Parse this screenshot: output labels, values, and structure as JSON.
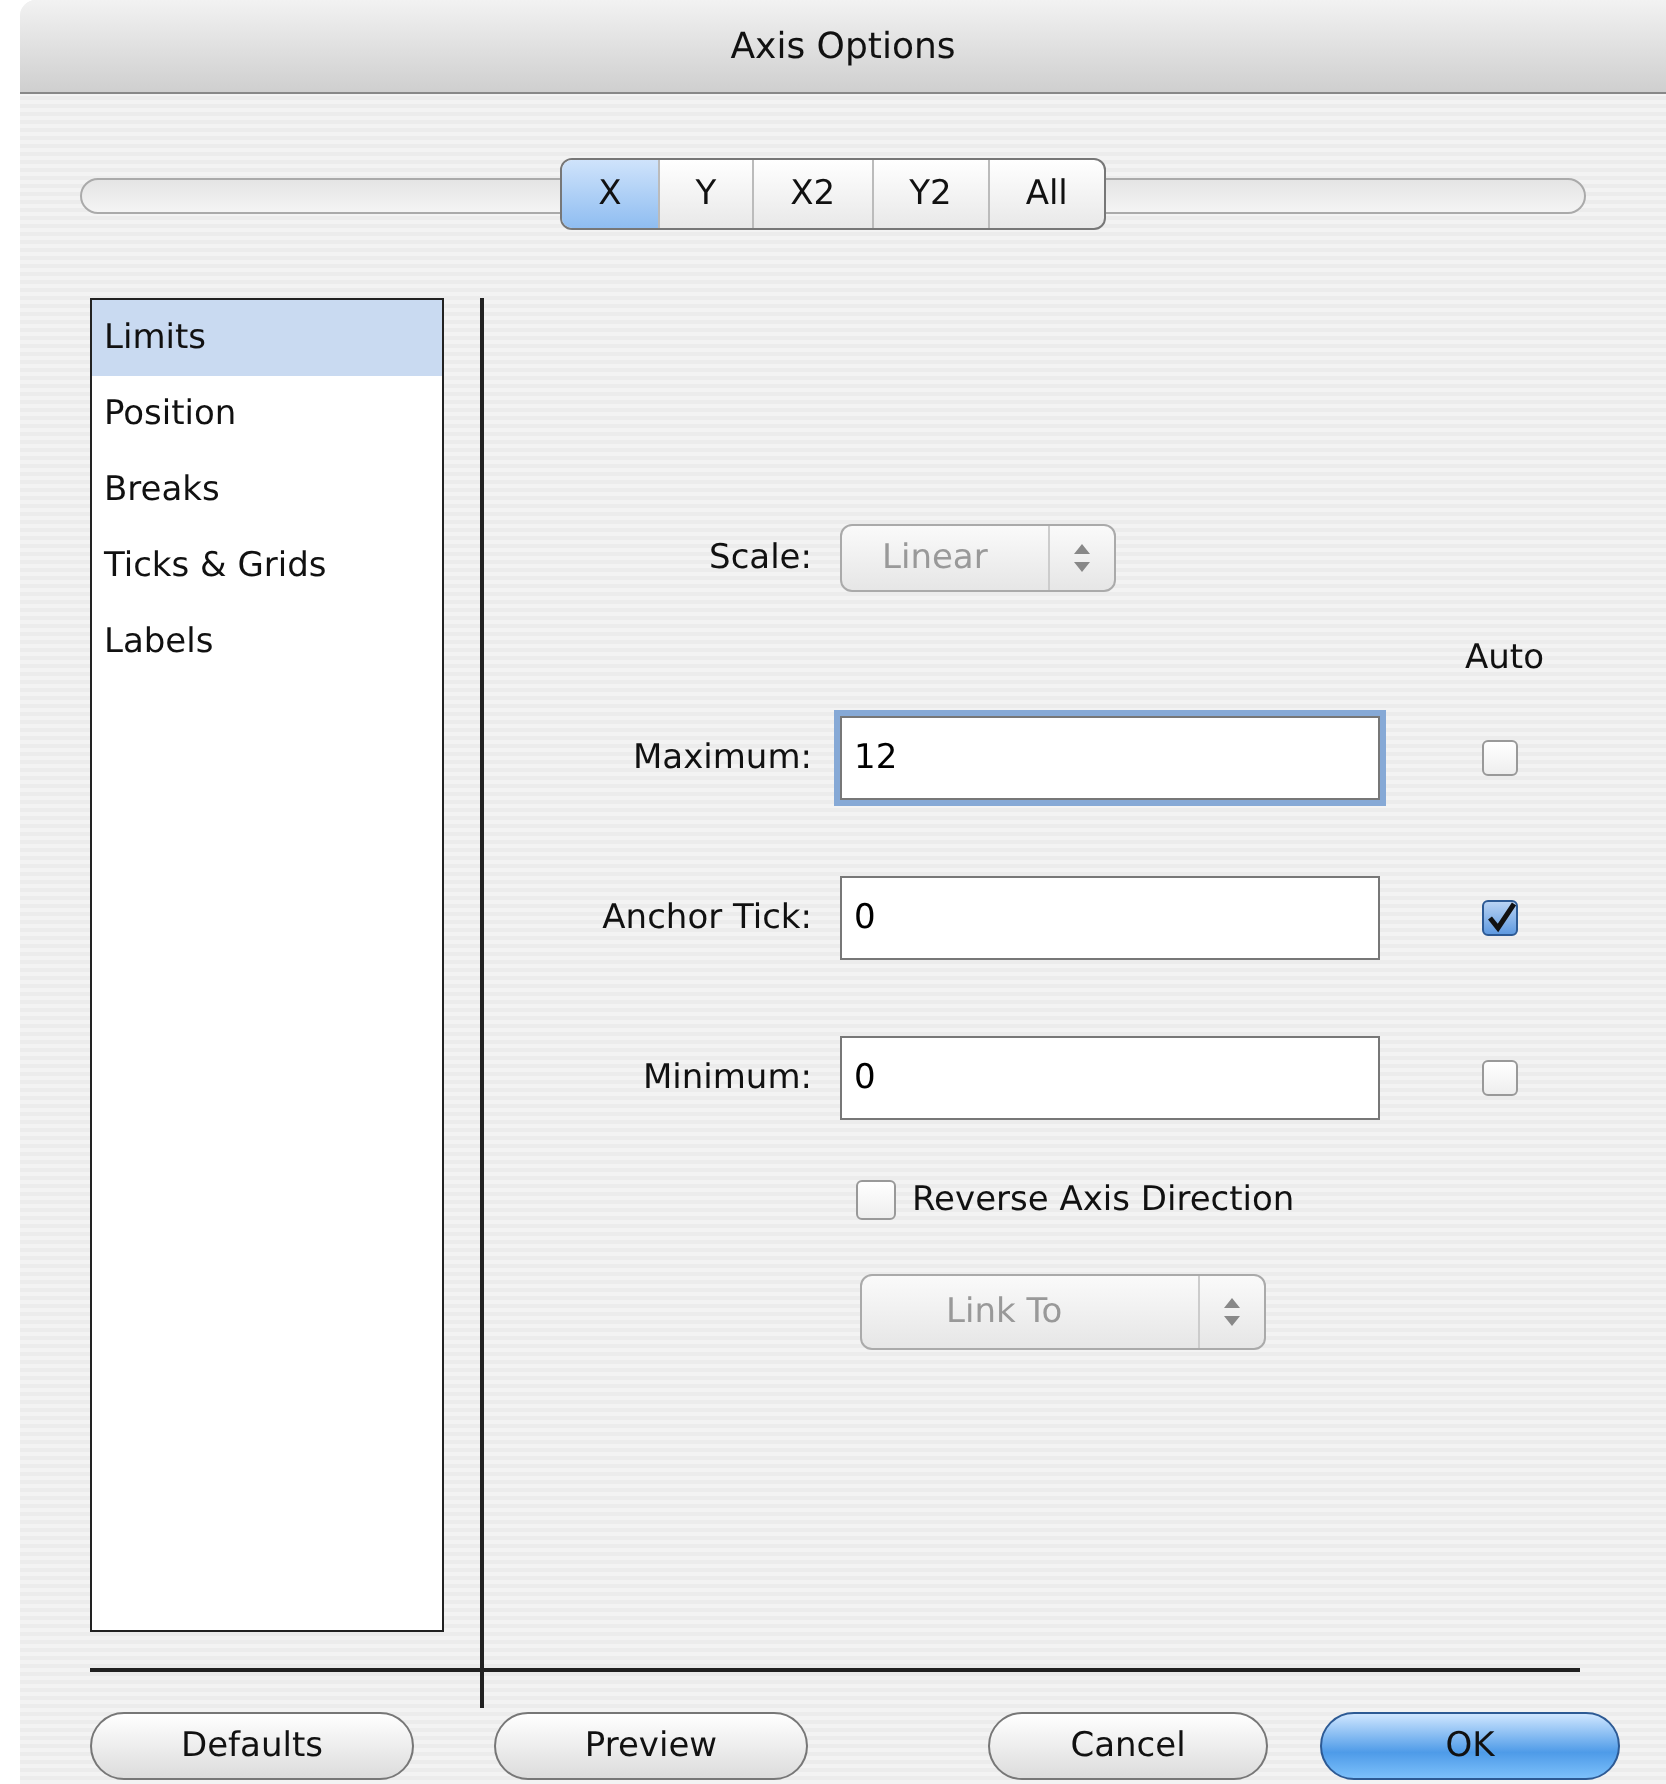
{
  "window": {
    "title": "Axis Options"
  },
  "tabs": [
    {
      "label": "X",
      "selected": true
    },
    {
      "label": "Y",
      "selected": false
    },
    {
      "label": "X2",
      "selected": false
    },
    {
      "label": "Y2",
      "selected": false
    },
    {
      "label": "All",
      "selected": false
    }
  ],
  "sidebar": {
    "items": [
      {
        "label": "Limits",
        "selected": true
      },
      {
        "label": "Position",
        "selected": false
      },
      {
        "label": "Breaks",
        "selected": false
      },
      {
        "label": "Ticks & Grids",
        "selected": false
      },
      {
        "label": "Labels",
        "selected": false
      }
    ]
  },
  "scale": {
    "label": "Scale:",
    "value": "Linear",
    "disabled": true
  },
  "auto_header": "Auto",
  "fields": [
    {
      "label": "Maximum:",
      "value": "12",
      "focused": true,
      "auto_checked": false
    },
    {
      "label": "Anchor Tick:",
      "value": "0",
      "focused": false,
      "auto_checked": true
    },
    {
      "label": "Minimum:",
      "value": "0",
      "focused": false,
      "auto_checked": false
    }
  ],
  "reverse": {
    "label": "Reverse Axis Direction",
    "checked": false
  },
  "link_to": {
    "value": "Link To",
    "disabled": true
  },
  "buttons": [
    {
      "label": "Defaults",
      "default": false
    },
    {
      "label": "Preview",
      "default": false
    },
    {
      "label": "Cancel",
      "default": false
    },
    {
      "label": "OK",
      "default": true
    }
  ]
}
